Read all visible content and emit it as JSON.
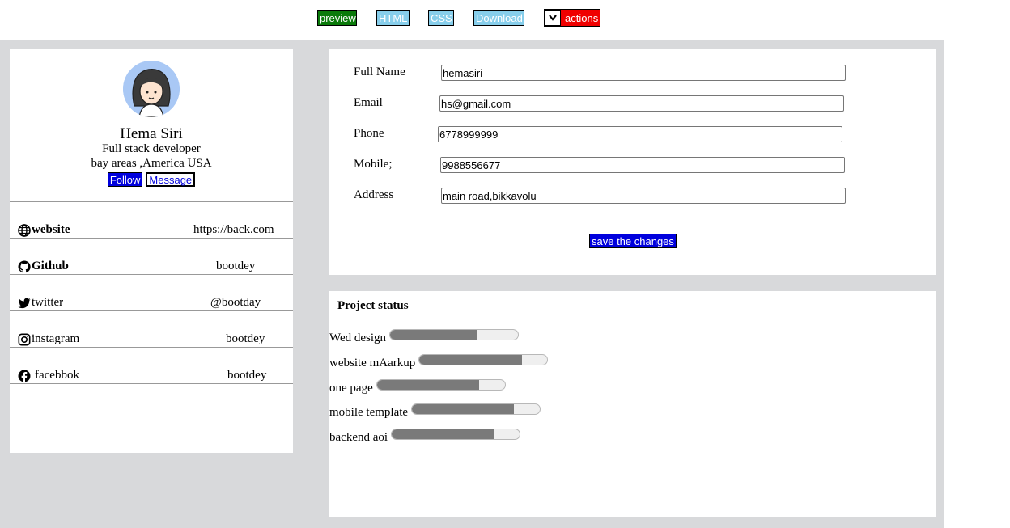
{
  "toolbar": {
    "preview": "preview",
    "html": "HTML",
    "css": "CSS",
    "download": "Download",
    "actions": "actions"
  },
  "profile": {
    "name": "Hema Siri",
    "role": "Full stack developer",
    "location": "bay areas ,America USA",
    "follow": "Follow",
    "message": "Message"
  },
  "links": [
    {
      "label": "website",
      "value": "https://back.com",
      "icon": "globe-icon"
    },
    {
      "label": "Github",
      "value": "bootdey",
      "icon": "github-icon"
    },
    {
      "label": "twitter",
      "value": "@bootday",
      "icon": "twitter-icon"
    },
    {
      "label": "instagram",
      "value": "bootdey",
      "icon": "instagram-icon"
    },
    {
      "label": "facebbok",
      "value": "bootdey",
      "icon": "facebook-icon"
    }
  ],
  "form": {
    "fullname_label": "Full Name",
    "fullname_value": "hemasiri",
    "email_label": "Email",
    "email_value": "hs@gmail.com",
    "phone_label": "Phone",
    "phone_value": "6778999999",
    "mobile_label": "Mobile;",
    "mobile_value": "9988556677",
    "address_label": "Address",
    "address_value": "main road,bikkavolu",
    "save": "save the changes"
  },
  "status": {
    "title": "Project status",
    "items": [
      {
        "label": "Wed design",
        "progress": 0.68
      },
      {
        "label": "website mAarkup",
        "progress": 0.8
      },
      {
        "label": "one page",
        "progress": 0.8
      },
      {
        "label": "mobile template",
        "progress": 0.8
      },
      {
        "label": "backend aoi",
        "progress": 0.8
      }
    ]
  },
  "colors": {
    "preview_bg": "#0a7a0a",
    "nav_bg": "#87ceeb",
    "actions_bg": "#f00000",
    "primary_blue": "#0000dd",
    "stage_bg": "#d8d9db",
    "progress_fill": "#7a7a7a"
  }
}
